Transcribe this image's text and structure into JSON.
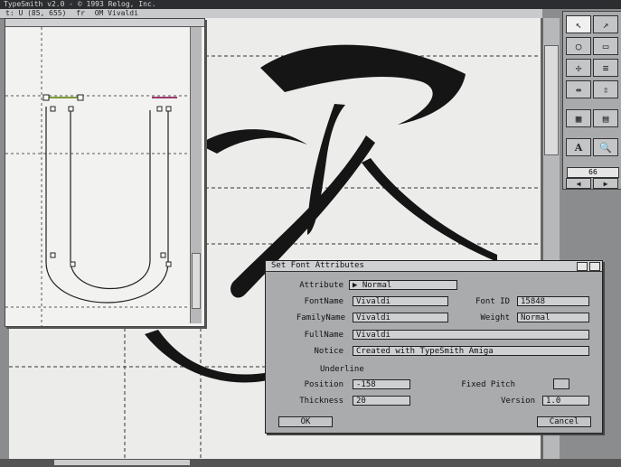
{
  "titlebar": {
    "title": "TypeSmith v2.0 - © 1993 Relog, Inc."
  },
  "statusbar": {
    "left": "t: U (85, 655)",
    "mid": "fr",
    "font": "OM Vivaldi"
  },
  "toolbox": {
    "zoom_value": "66"
  },
  "dialog": {
    "title": "Set Font Attributes",
    "attribute_label": "Attribute",
    "attribute_value": "▶ Normal",
    "fontname_label": "FontName",
    "fontname_value": "Vivaldi",
    "fontid_label": "Font ID",
    "fontid_value": "15848",
    "familyname_label": "FamilyName",
    "familyname_value": "Vivaldi",
    "weight_label": "Weight",
    "weight_value": "Normal",
    "fullname_label": "FullName",
    "fullname_value": "Vivaldi",
    "notice_label": "Notice",
    "notice_value": "Created with TypeSmith Amiga",
    "underline_heading": "Underline",
    "position_label": "Position",
    "position_value": "-158",
    "thickness_label": "Thickness",
    "thickness_value": "20",
    "fixedpitch_label": "Fixed Pitch",
    "version_label": "Version",
    "version_value": "1.0",
    "ok_label": "OK",
    "cancel_label": "Cancel"
  }
}
